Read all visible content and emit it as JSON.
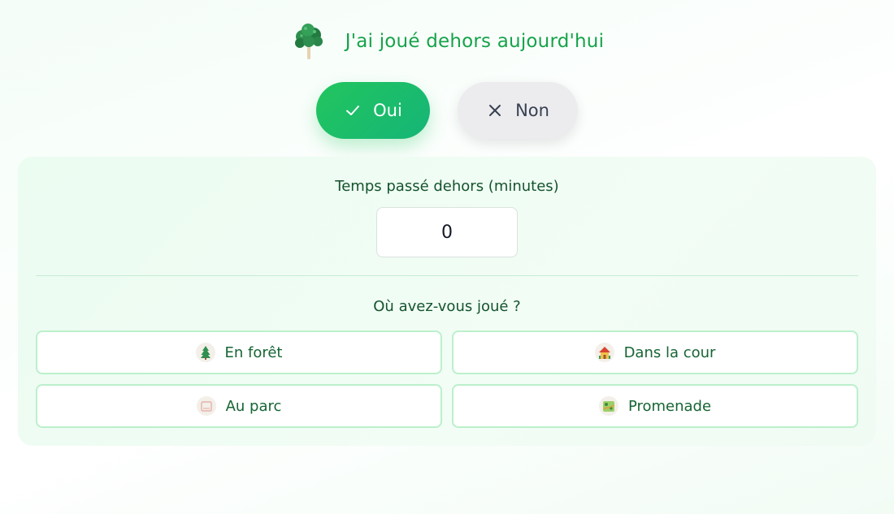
{
  "header": {
    "icon": "tree-icon",
    "title": "J'ai joué dehors aujourd'hui"
  },
  "choice": {
    "yes_label": "Oui",
    "yes_icon": "check-icon",
    "no_label": "Non",
    "no_icon": "close-icon",
    "selected": "yes"
  },
  "time": {
    "label": "Temps passé dehors (minutes)",
    "value": "0"
  },
  "places": {
    "label": "Où avez-vous joué ?",
    "items": [
      {
        "label": "En forêt",
        "icon": "pine-tree-icon"
      },
      {
        "label": "Dans la cour",
        "icon": "house-icon"
      },
      {
        "label": "Au parc",
        "icon": "park-icon"
      },
      {
        "label": "Promenade",
        "icon": "walk-icon"
      }
    ]
  },
  "colors": {
    "accent": "#22c55e",
    "title": "#16a34a",
    "text": "#14532d",
    "panel": "#ecfcf1",
    "border": "#bbf0cc"
  }
}
